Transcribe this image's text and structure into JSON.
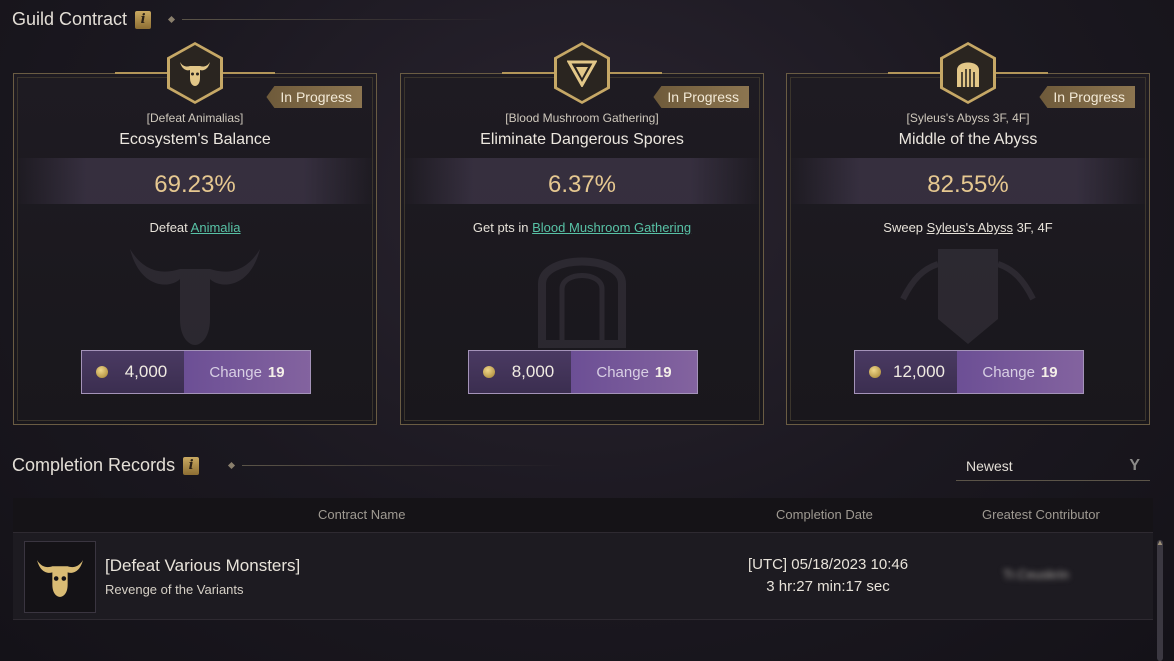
{
  "guild_contract": {
    "title": "Guild Contract"
  },
  "cards": [
    {
      "status": "In Progress",
      "subtitle": "[Defeat Animalias]",
      "title": "Ecosystem's Balance",
      "percent": "69.23%",
      "desc_prefix": "Defeat ",
      "desc_link": "Animalia",
      "desc_suffix": "",
      "reward_amount": "4,000",
      "change_label": "Change",
      "change_count": "19",
      "emblem": "bull-horns-icon"
    },
    {
      "status": "In Progress",
      "subtitle": "[Blood Mushroom Gathering]",
      "title": "Eliminate Dangerous Spores",
      "percent": "6.37%",
      "desc_prefix": "Get pts in ",
      "desc_link": "Blood Mushroom Gathering",
      "desc_suffix": "",
      "reward_amount": "8,000",
      "change_label": "Change",
      "change_count": "19",
      "emblem": "triangle-shield-icon"
    },
    {
      "status": "In Progress",
      "subtitle": "[Syleus's Abyss 3F, 4F]",
      "title": "Middle of the Abyss",
      "percent": "82.55%",
      "desc_prefix": "Sweep ",
      "desc_link": "Syleus's Abyss",
      "desc_suffix": " 3F, 4F",
      "reward_amount": "12,000",
      "change_label": "Change",
      "change_count": "19",
      "emblem": "gate-icon"
    }
  ],
  "completion_records": {
    "title": "Completion Records",
    "sort": {
      "selected": "Newest"
    },
    "columns": [
      "Contract Name",
      "Completion Date",
      "Greatest Contributor"
    ],
    "rows": [
      {
        "title": "[Defeat Various Monsters]",
        "subtitle": "Revenge of the Variants",
        "date": "[UTC] 05/18/2023 10:46",
        "duration": "3 hr:27 min:17 sec",
        "contributor": "Tr.Ceuskrin",
        "icon": "bull-horns-icon"
      }
    ]
  },
  "colors": {
    "accent_gold": "#c6a866",
    "percent": "#e6c890",
    "link": "#58c2a6",
    "reward_purple": "#6c4f95"
  }
}
